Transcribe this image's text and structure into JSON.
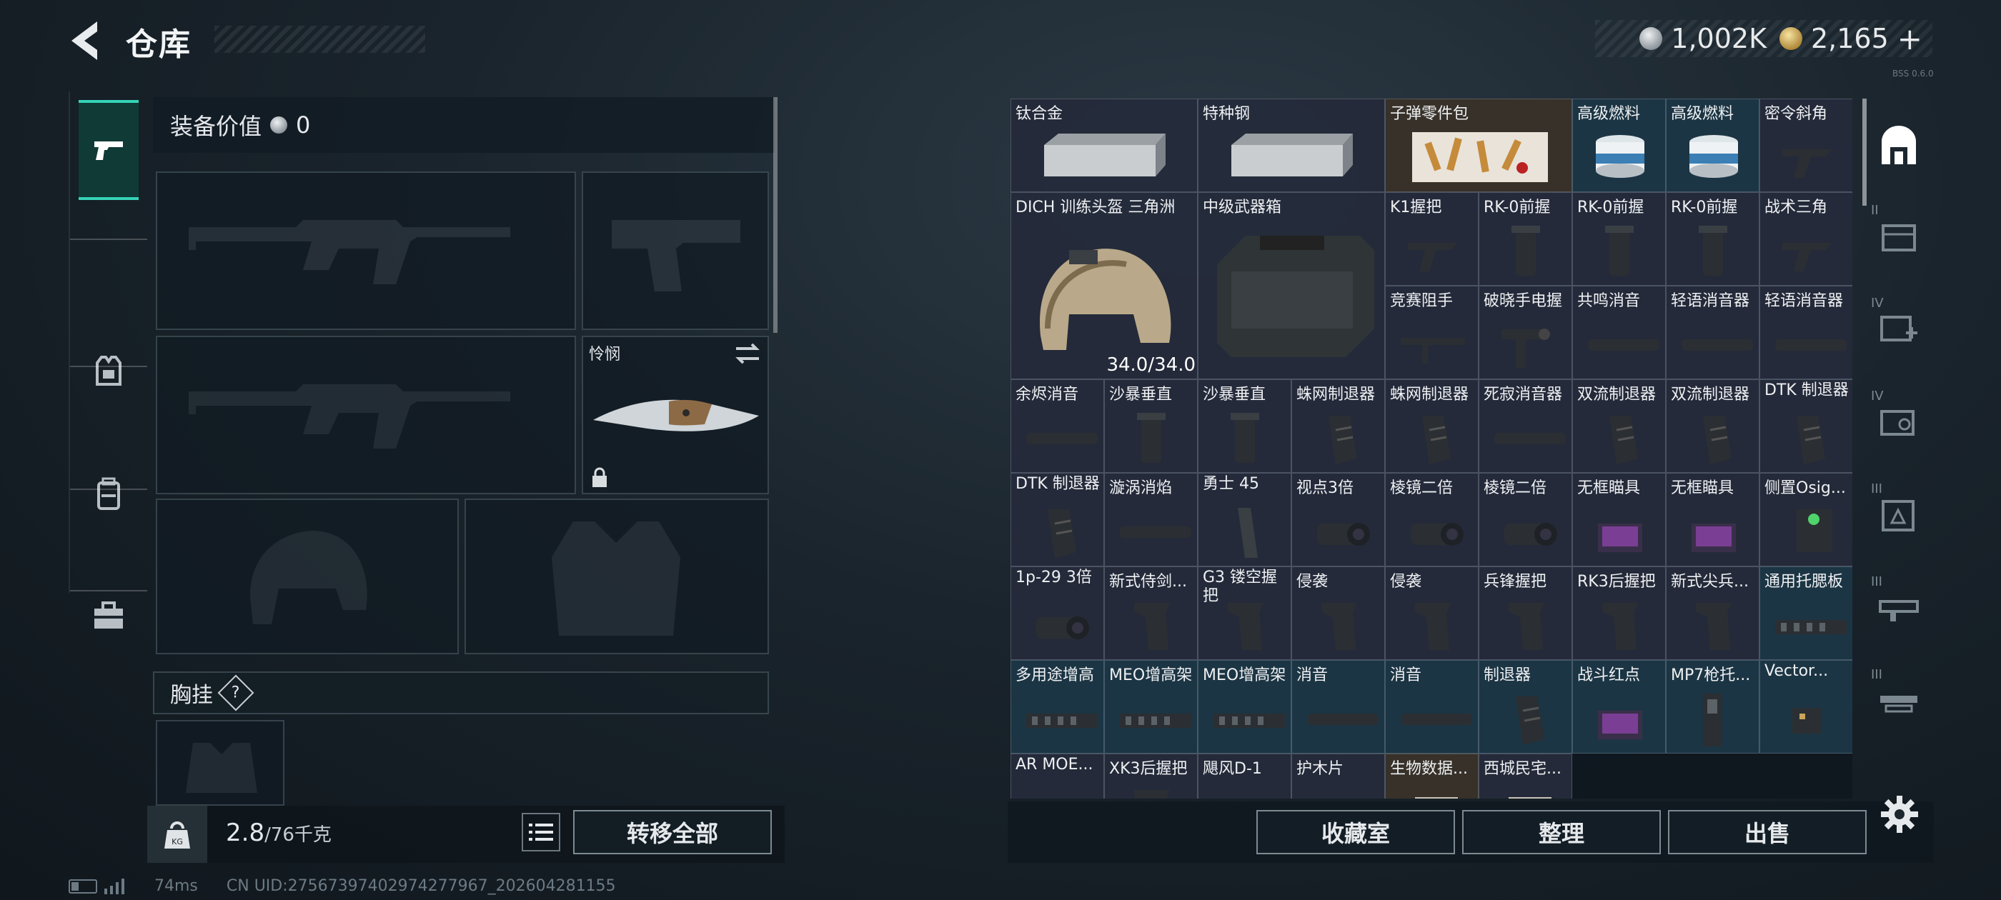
{
  "header": {
    "title": "仓库"
  },
  "currency": {
    "silver": "1,002K",
    "gold": "2,165",
    "gold_plus": "+"
  },
  "version": "BSS 0.6.0",
  "equipment": {
    "value_label": "装备价值",
    "value": "0",
    "melee_slot_label": "怜悯",
    "rig_label": "胸挂",
    "help": "?"
  },
  "weight": {
    "current": "2.8",
    "max": "/76千克"
  },
  "buttons": {
    "transfer_all": "转移全部",
    "collection": "收藏室",
    "organize": "整理",
    "sell": "出售"
  },
  "status": {
    "ping": "74ms",
    "uid": "CN UID:2756739740297427796​7_202604281155"
  },
  "storage": {
    "cells": [
      {
        "label": "钛合金"
      },
      {
        "label": "特种钢"
      },
      {
        "label": "子弹零件包"
      },
      {
        "label": "高级燃料"
      },
      {
        "label": "高级燃料"
      },
      {
        "label": "密令斜角"
      },
      {
        "label": "DICH 训练头盔 三角洲",
        "durability": "34.0/34.0"
      },
      {
        "label": "中级武器箱"
      },
      {
        "label": "K1握把"
      },
      {
        "label": "RK-0前握"
      },
      {
        "label": "RK-0前握"
      },
      {
        "label": "RK-0前握"
      },
      {
        "label": "战术三角"
      },
      {
        "label": "竞赛阻手"
      },
      {
        "label": "破晓手电握"
      },
      {
        "label": "共鸣消音"
      },
      {
        "label": "轻语消音器"
      },
      {
        "label": "轻语消音器"
      },
      {
        "label": "余烬消音"
      },
      {
        "label": "沙暴垂直"
      },
      {
        "label": "沙暴垂直"
      },
      {
        "label": "蛛网制退器"
      },
      {
        "label": "蛛网制退器"
      },
      {
        "label": "死寂消音器"
      },
      {
        "label": "双流制退器"
      },
      {
        "label": "双流制退器"
      },
      {
        "label": "DTK 制退器"
      },
      {
        "label": "DTK 制退器"
      },
      {
        "label": "漩涡消焰"
      },
      {
        "label": "勇士 45"
      },
      {
        "label": "视点3倍"
      },
      {
        "label": "棱镜二倍"
      },
      {
        "label": "棱镜二倍"
      },
      {
        "label": "无框瞄具"
      },
      {
        "label": "无框瞄具"
      },
      {
        "label": "侧置Osig..."
      },
      {
        "label": "1p-29 3倍"
      },
      {
        "label": "新式侍剑..."
      },
      {
        "label": "G3 镂空握把"
      },
      {
        "label": "侵袭"
      },
      {
        "label": "侵袭"
      },
      {
        "label": "兵锋握把"
      },
      {
        "label": "RK3后握把"
      },
      {
        "label": "新式尖兵..."
      },
      {
        "label": "通用托腮板"
      },
      {
        "label": "多用途增高"
      },
      {
        "label": "MEO增高架"
      },
      {
        "label": "MEO增高架"
      },
      {
        "label": "消音"
      },
      {
        "label": "消音"
      },
      {
        "label": "制退器"
      },
      {
        "label": "战斗红点"
      },
      {
        "label": "MP7枪托..."
      },
      {
        "label": "Vector..."
      },
      {
        "label": "AR MOE..."
      },
      {
        "label": "XK3后握把"
      },
      {
        "label": "飓风D-1"
      },
      {
        "label": "护木片"
      },
      {
        "label": "生物数据..."
      },
      {
        "label": "西城民宅..."
      }
    ]
  },
  "rail": {
    "tiers": [
      "II",
      "IV",
      "IV",
      "III",
      "III",
      "III"
    ]
  }
}
